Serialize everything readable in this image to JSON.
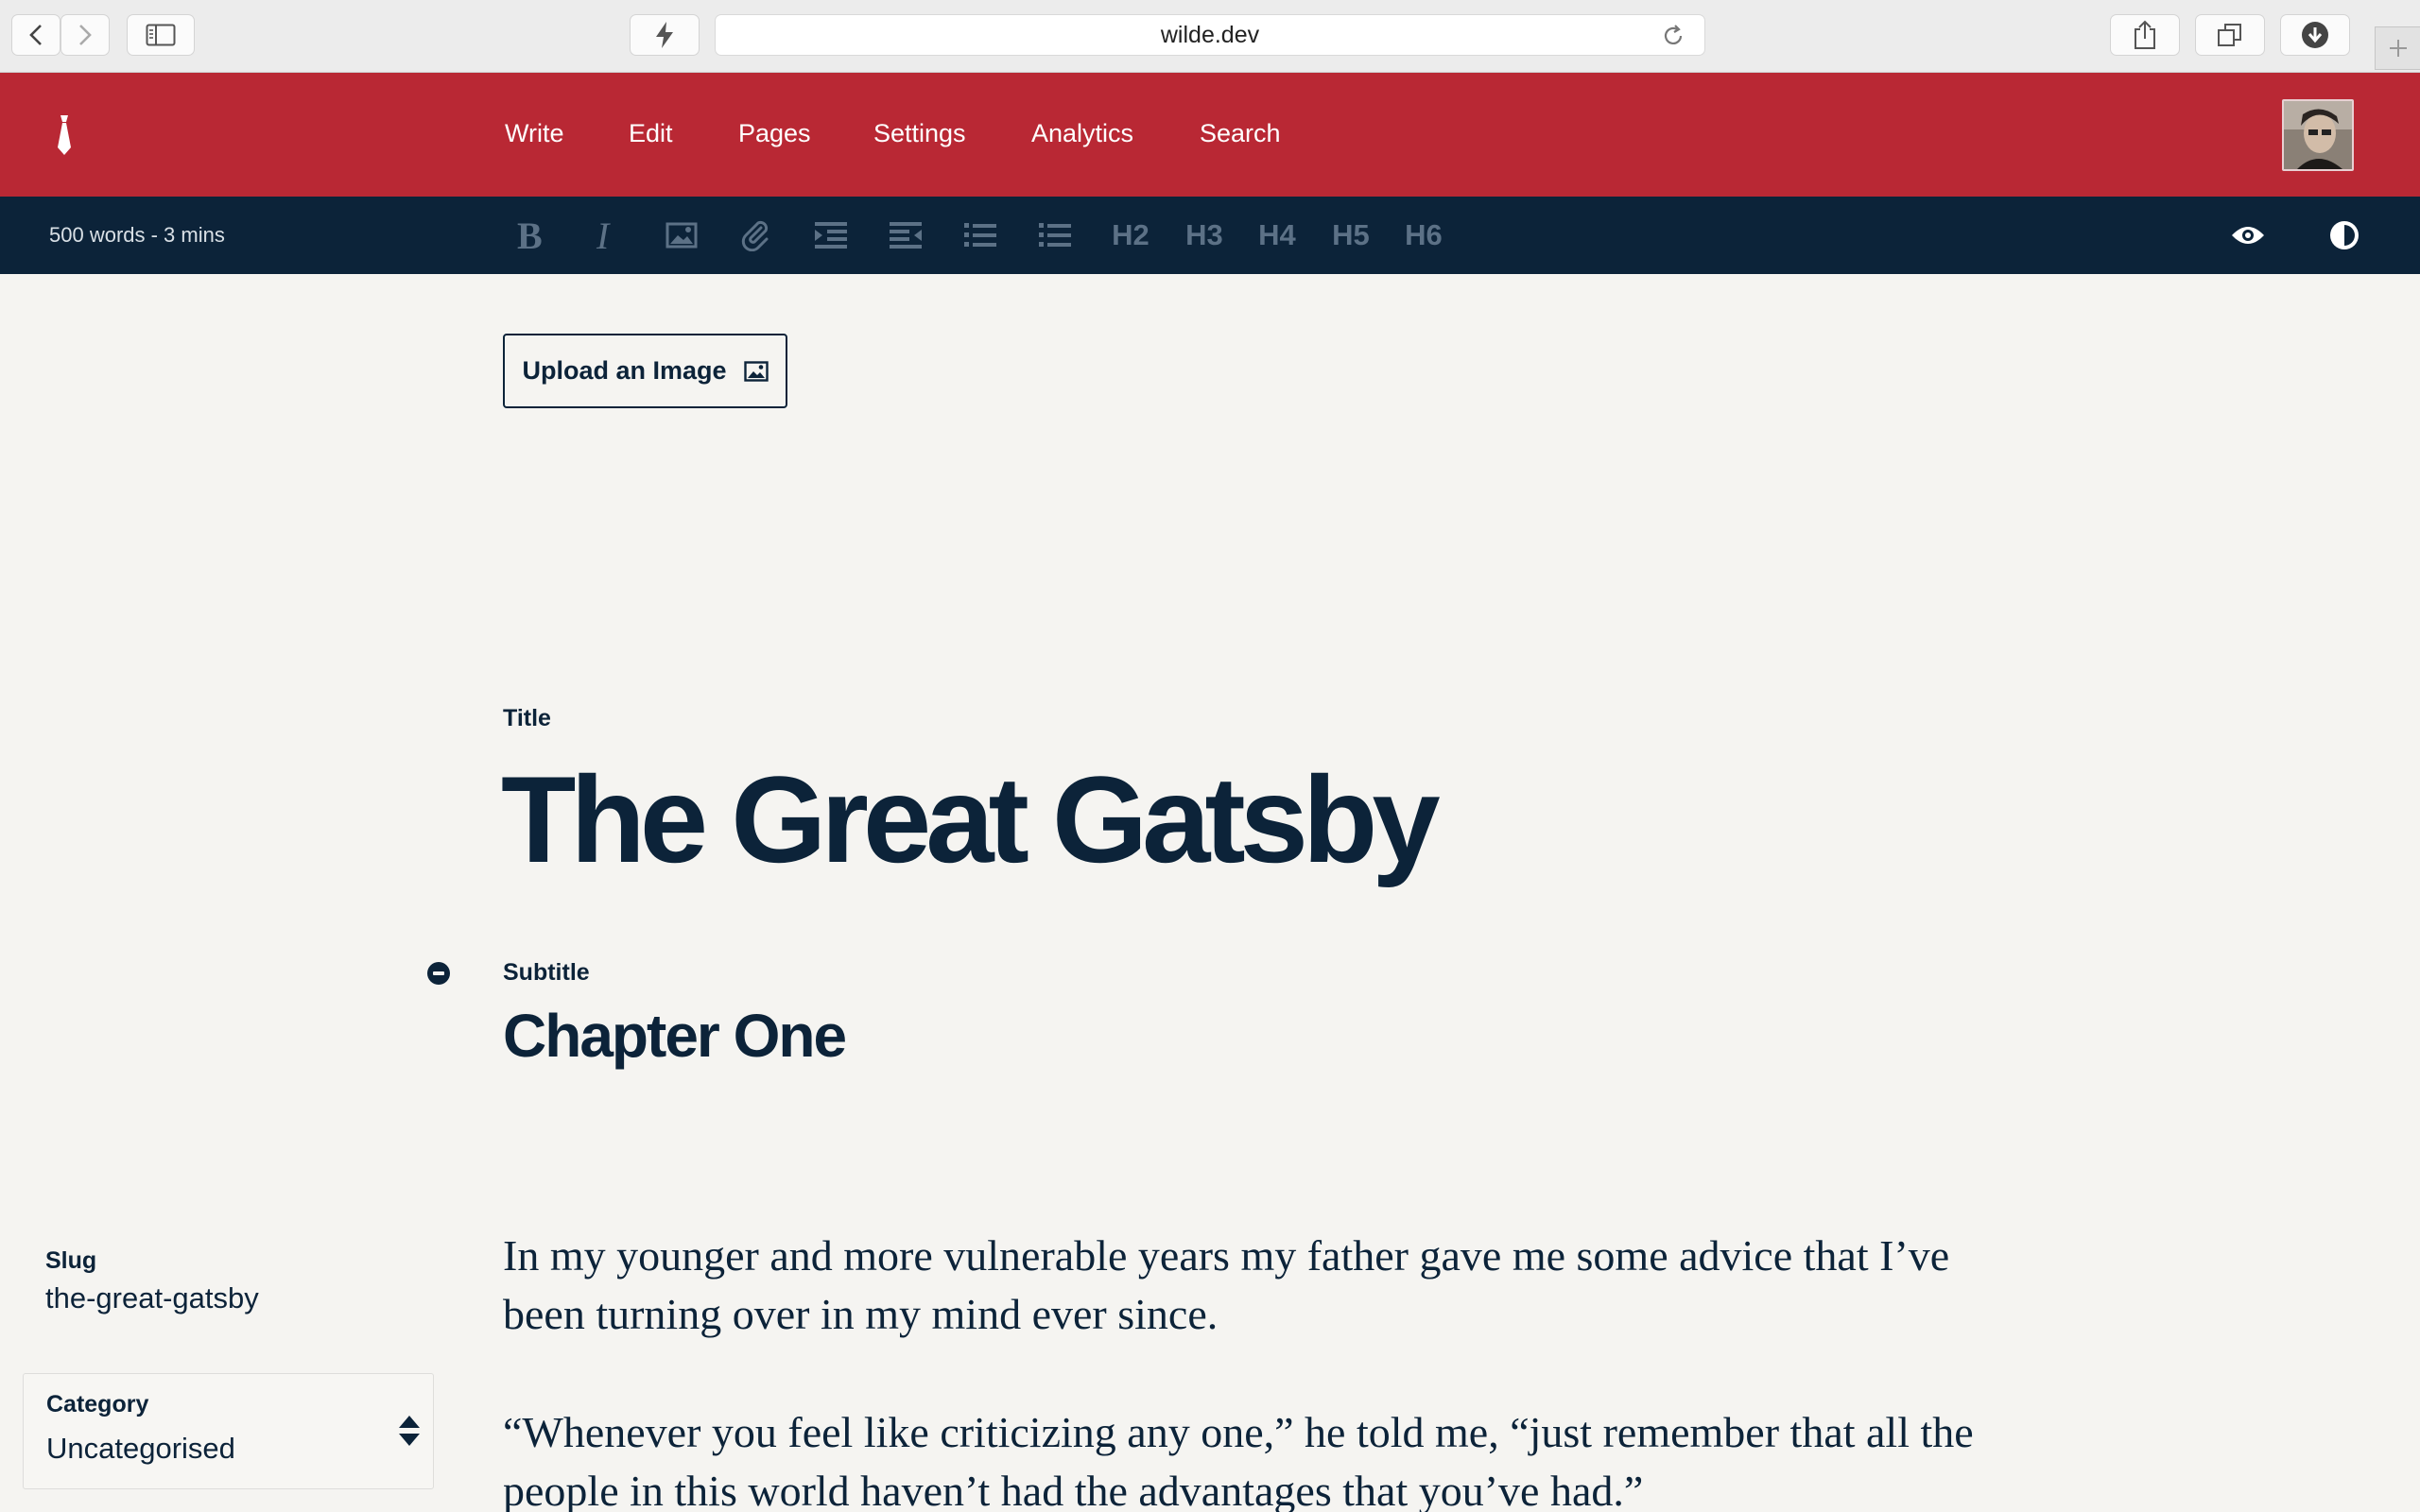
{
  "browser": {
    "url": "wilde.dev"
  },
  "nav": {
    "items": [
      {
        "label": "Write"
      },
      {
        "label": "Edit"
      },
      {
        "label": "Pages"
      },
      {
        "label": "Settings"
      },
      {
        "label": "Analytics"
      },
      {
        "label": "Search"
      }
    ],
    "brand_color": "#b92834"
  },
  "toolbar": {
    "word_count": "500 words - 3 mins",
    "format_buttons": [
      "bold-icon",
      "italic-icon",
      "image-icon",
      "attachment-icon",
      "indent-icon",
      "outdent-icon",
      "bulleted-list-icon",
      "numbered-list-icon"
    ],
    "headings": [
      "H2",
      "H3",
      "H4",
      "H5",
      "H6"
    ],
    "right_icons": [
      "preview-eye-icon",
      "contrast-toggle-icon"
    ],
    "background_color": "#0c2339"
  },
  "editor": {
    "upload_label": "Upload an Image",
    "title_label": "Title",
    "title": "The Great Gatsby",
    "subtitle_label": "Subtitle",
    "subtitle": "Chapter One",
    "paragraphs": [
      "In my younger and more vulnerable years my father gave me some advice that I’ve been turning over in my mind ever since.",
      "“Whenever you feel like criticizing any one,” he told me, “just remember that all the people in this world haven’t had the advantages that you’ve had.”"
    ]
  },
  "sidebar": {
    "slug_label": "Slug",
    "slug": "the-great-gatsby",
    "category_label": "Category",
    "category": "Uncategorised"
  }
}
